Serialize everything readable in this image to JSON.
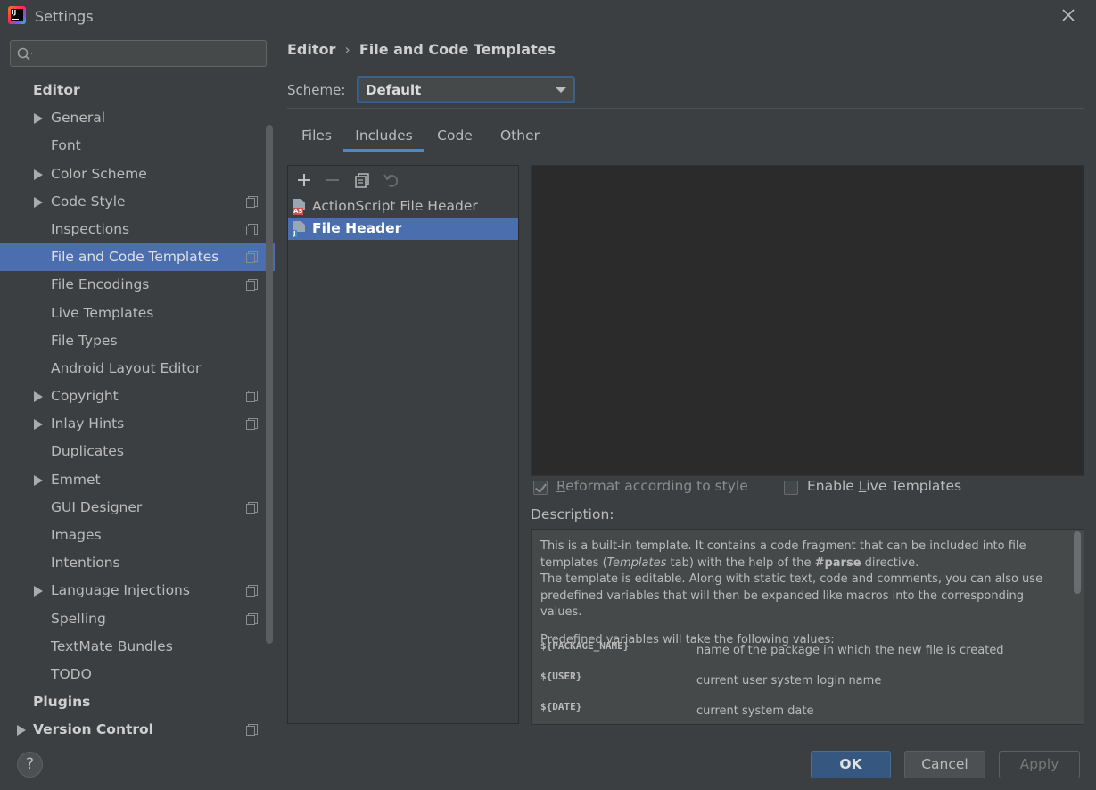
{
  "window": {
    "title": "Settings"
  },
  "search": {
    "placeholder": "",
    "value": ""
  },
  "sidebar": {
    "items": [
      {
        "label": "Editor",
        "level": 0,
        "arrow": false,
        "config": false,
        "selected": false
      },
      {
        "label": "General",
        "level": 1,
        "arrow": true,
        "config": false,
        "selected": false
      },
      {
        "label": "Font",
        "level": 1,
        "arrow": false,
        "config": false,
        "selected": false
      },
      {
        "label": "Color Scheme",
        "level": 1,
        "arrow": true,
        "config": false,
        "selected": false
      },
      {
        "label": "Code Style",
        "level": 1,
        "arrow": true,
        "config": true,
        "selected": false
      },
      {
        "label": "Inspections",
        "level": 1,
        "arrow": false,
        "config": true,
        "selected": false
      },
      {
        "label": "File and Code Templates",
        "level": 1,
        "arrow": false,
        "config": true,
        "selected": true
      },
      {
        "label": "File Encodings",
        "level": 1,
        "arrow": false,
        "config": true,
        "selected": false
      },
      {
        "label": "Live Templates",
        "level": 1,
        "arrow": false,
        "config": false,
        "selected": false
      },
      {
        "label": "File Types",
        "level": 1,
        "arrow": false,
        "config": false,
        "selected": false
      },
      {
        "label": "Android Layout Editor",
        "level": 1,
        "arrow": false,
        "config": false,
        "selected": false
      },
      {
        "label": "Copyright",
        "level": 1,
        "arrow": true,
        "config": true,
        "selected": false
      },
      {
        "label": "Inlay Hints",
        "level": 1,
        "arrow": true,
        "config": true,
        "selected": false
      },
      {
        "label": "Duplicates",
        "level": 1,
        "arrow": false,
        "config": false,
        "selected": false
      },
      {
        "label": "Emmet",
        "level": 1,
        "arrow": true,
        "config": false,
        "selected": false
      },
      {
        "label": "GUI Designer",
        "level": 1,
        "arrow": false,
        "config": true,
        "selected": false
      },
      {
        "label": "Images",
        "level": 1,
        "arrow": false,
        "config": false,
        "selected": false
      },
      {
        "label": "Intentions",
        "level": 1,
        "arrow": false,
        "config": false,
        "selected": false
      },
      {
        "label": "Language Injections",
        "level": 1,
        "arrow": true,
        "config": true,
        "selected": false
      },
      {
        "label": "Spelling",
        "level": 1,
        "arrow": false,
        "config": true,
        "selected": false
      },
      {
        "label": "TextMate Bundles",
        "level": 1,
        "arrow": false,
        "config": false,
        "selected": false
      },
      {
        "label": "TODO",
        "level": 1,
        "arrow": false,
        "config": false,
        "selected": false
      },
      {
        "label": "Plugins",
        "level": 0,
        "arrow": false,
        "config": false,
        "selected": false
      },
      {
        "label": "Version Control",
        "level": 0,
        "arrow": true,
        "config": true,
        "selected": false
      }
    ]
  },
  "breadcrumb": {
    "parent": "Editor",
    "separator": "›",
    "current": "File and Code Templates"
  },
  "scheme": {
    "label": "Scheme:",
    "value": "Default"
  },
  "tabs": [
    {
      "label": "Files",
      "active": false
    },
    {
      "label": "Includes",
      "active": true
    },
    {
      "label": "Code",
      "active": false
    },
    {
      "label": "Other",
      "active": false
    }
  ],
  "templates": [
    {
      "label": "ActionScript File Header",
      "badge": "AS",
      "badge_color": "#c75450",
      "selected": false
    },
    {
      "label": "File Header",
      "badge": "J",
      "badge_color": "#3592c4",
      "selected": true
    }
  ],
  "options": {
    "reformat_pre": "",
    "reformat_u": "R",
    "reformat_post": "eformat according to style",
    "reformat_checked": true,
    "live_pre": "Enable ",
    "live_u": "L",
    "live_post": "ive Templates",
    "live_checked": false
  },
  "description": {
    "label": "Description:",
    "line1": "This is a built-in template. It contains a code fragment that can be included into file",
    "line2_a": "templates (",
    "line2_em": "Templates",
    "line2_b": " tab) with the help of the ",
    "line2_strong": "#parse",
    "line2_c": " directive.",
    "line3": "The template is editable. Along with static text, code and comments, you can also use",
    "line4": "predefined variables that will then be expanded like macros into the corresponding values.",
    "line5": "Predefined variables will take the following values:",
    "variables": [
      {
        "name": "${PACKAGE_NAME}",
        "desc": "name of the package in which the new file is created"
      },
      {
        "name": "${USER}",
        "desc": "current user system login name"
      },
      {
        "name": "${DATE}",
        "desc": "current system date"
      }
    ]
  },
  "buttons": {
    "help": "?",
    "ok": "OK",
    "cancel": "Cancel",
    "apply": "Apply"
  },
  "colors": {
    "accent": "#4b6eaf",
    "background": "#3c3f41",
    "editor_bg": "#2b2b2b",
    "ok_button": "#365880"
  }
}
